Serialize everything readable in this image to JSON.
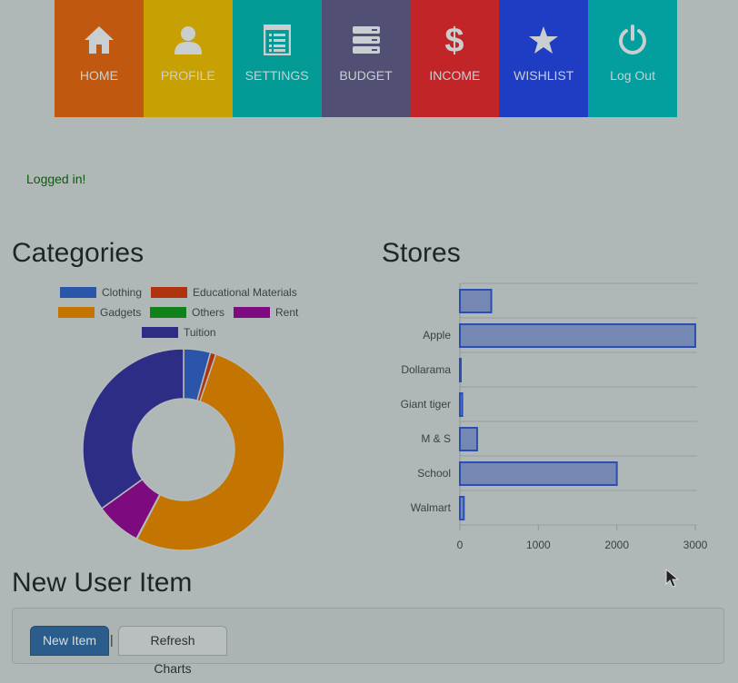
{
  "nav": {
    "items": [
      {
        "label": "HOME",
        "icon": "home-icon",
        "color": "#c1580f"
      },
      {
        "label": "PROFILE",
        "icon": "user-icon",
        "color": "#c7a004"
      },
      {
        "label": "SETTINGS",
        "icon": "list-icon",
        "color": "#049a96"
      },
      {
        "label": "BUDGET",
        "icon": "server-icon",
        "color": "#524f74"
      },
      {
        "label": "INCOME",
        "icon": "dollar-icon",
        "color": "#c12528"
      },
      {
        "label": "WISHLIST",
        "icon": "star-icon",
        "color": "#1e3dc3"
      },
      {
        "label": "Log Out",
        "icon": "power-icon",
        "color": "#039e9e"
      }
    ]
  },
  "status": "Logged in!",
  "categories": {
    "title": "Categories"
  },
  "stores": {
    "title": "Stores"
  },
  "new_item": {
    "title": "New User Item",
    "new_item_label": "New Item",
    "separator": "|",
    "refresh_label": "Refresh Charts"
  },
  "chart_data": [
    {
      "type": "pie",
      "title": "Categories",
      "donut": true,
      "legend_position": "top",
      "labels": [
        "Clothing",
        "Educational Materials",
        "Gadgets",
        "Others",
        "Rent",
        "Tuition"
      ],
      "values": [
        4.3,
        0.9,
        52.4,
        0.1,
        7.3,
        34.9
      ],
      "colors": [
        "#2b55a8",
        "#b0330f",
        "#c47400",
        "#10821a",
        "#7d0a7e",
        "#2e2d85"
      ]
    },
    {
      "type": "bar",
      "orientation": "horizontal",
      "title": "Stores",
      "categories": [
        "",
        "Apple",
        "Dollarama",
        "Giant tiger",
        "M & S",
        "School",
        "Walmart"
      ],
      "values": [
        400,
        3000,
        10,
        30,
        220,
        2000,
        50
      ],
      "xlim": [
        0,
        3000
      ],
      "xticks": [
        "0",
        "1000",
        "2000",
        "3000"
      ],
      "grid": true,
      "bar_fill": "#7588b3",
      "bar_stroke": "#2a4fb0"
    }
  ]
}
